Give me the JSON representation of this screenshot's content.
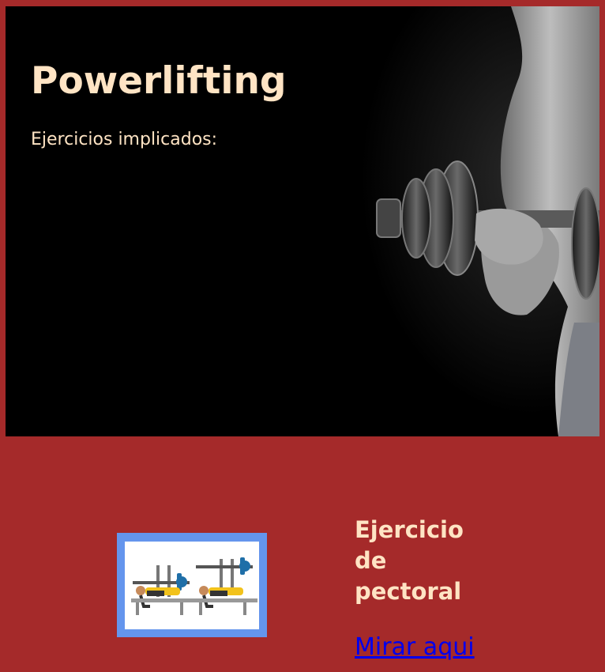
{
  "hero": {
    "title": "Powerlifting",
    "subtitle": "Ejercicios implicados:"
  },
  "card": {
    "title": "Ejercicio de pectoral",
    "link_label": "Mirar aqui"
  },
  "colors": {
    "page_background": "#a52a2a",
    "text_accent": "#ffe4c4",
    "thumbnail_border": "#6495ed",
    "link": "#0000ee"
  }
}
